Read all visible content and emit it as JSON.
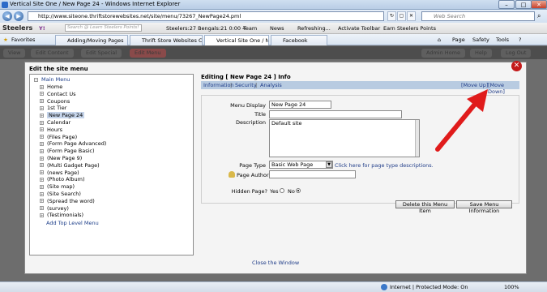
{
  "window": {
    "title": "Vertical Site One / New Page 24 - Windows Internet Explorer"
  },
  "address": {
    "url": "http://www.siteone.thriftstorewebsites.net/site/menu/73267_NewPage24.pml",
    "search_placeholder": "Web Search"
  },
  "toolbar": {
    "brand": "Steelers",
    "search_placeholder": "Search @ Learn Steelers Points!",
    "score": "Steelers:27 Bengals:21 0:00 4",
    "team": "Team",
    "news": "News",
    "refresh": "Refreshing...",
    "activate": "Activate Toolbar",
    "earn": "Earn Steelers Points"
  },
  "favbar": {
    "favorites": "Favorites",
    "tabs": [
      "Adding/Moving Pages",
      "Thrift Store Websites Creat...",
      "Vertical Site One / New ...",
      "Facebook"
    ],
    "page": "Page",
    "safety": "Safety",
    "tools": "Tools"
  },
  "appnav": {
    "items": [
      "View",
      "Edit Content",
      "Edit Special",
      "Edit Menu"
    ],
    "right": [
      "Admin Home",
      "Help",
      "Log Out"
    ]
  },
  "dialog": {
    "title": "Edit the site menu",
    "close_link": "Close the Window"
  },
  "menu": {
    "root": "Main Menu",
    "items": [
      "Home",
      "Contact Us",
      "Coupons",
      "1st Tier",
      "New Page 24",
      "Calendar",
      "Hours",
      "(Files Page)",
      "(Form Page Advanced)",
      "(Form Page Basic)",
      "(New Page 9)",
      "(Multi Gadget Page)",
      "(news Page)",
      "(Photo Album)",
      "(Site map)",
      "(Site Search)",
      "(Spread the word)",
      "(survey)",
      "(Testimonials)"
    ],
    "selected": "New Page 24",
    "add_link": "Add Top Level Menu"
  },
  "editing": {
    "title": "Editing [ New Page 24 ] Info",
    "tabs": [
      "Information",
      "Security",
      "Analysis"
    ],
    "move_up": "[Move Up]",
    "move_down": "[Move Down]",
    "labels": {
      "menu_display": "Menu Display",
      "title": "Title",
      "description": "Description",
      "page_type": "Page Type",
      "page_author": "Page Author",
      "hidden_page": "Hidden Page?",
      "yes": "Yes",
      "no": "No"
    },
    "values": {
      "menu_display": "New Page 24",
      "title": "",
      "description": "Default site",
      "page_type": "Basic Web Page",
      "page_author": ""
    },
    "page_type_help": "Click here for page type descriptions.",
    "delete_button": "Delete this Menu Item",
    "save_button": "Save Menu Information"
  },
  "status": {
    "zone": "Internet | Protected Mode: On",
    "zoom": "100%"
  },
  "colors": {
    "arrow": "#e01b1b",
    "link": "#1f3c88",
    "header_bar": "#b8cbe1"
  }
}
